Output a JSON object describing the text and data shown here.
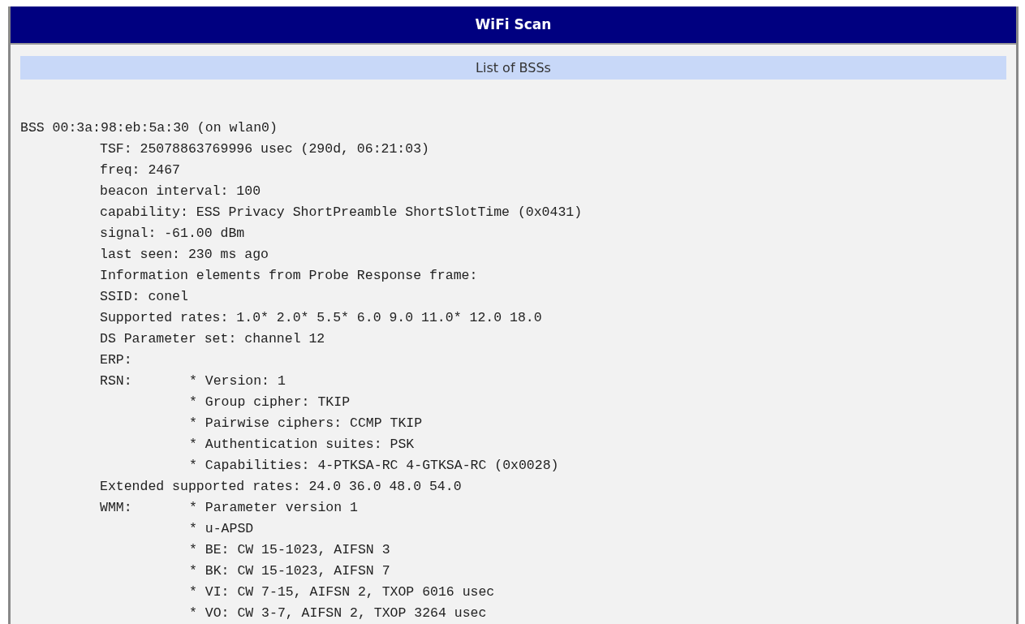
{
  "window": {
    "title": "WiFi Scan"
  },
  "section": {
    "title": "List of BSSs"
  },
  "scan": {
    "header": "BSS 00:3a:98:eb:5a:30 (on wlan0)",
    "fields": [
      {
        "text": "TSF: 25078863769996 usec (290d, 06:21:03)"
      },
      {
        "text": "freq: 2467"
      },
      {
        "text": "beacon interval: 100"
      },
      {
        "text": "capability: ESS Privacy ShortPreamble ShortSlotTime (0x0431)"
      },
      {
        "text": "signal: -61.00 dBm"
      },
      {
        "text": "last seen: 230 ms ago"
      },
      {
        "text": "Information elements from Probe Response frame:"
      },
      {
        "text": "SSID: conel"
      },
      {
        "text": "Supported rates: 1.0* 2.0* 5.5* 6.0 9.0 11.0* 12.0 18.0"
      },
      {
        "text": "DS Parameter set: channel 12"
      },
      {
        "text": "ERP:"
      },
      {
        "label": "RSN:",
        "items": [
          "* Version: 1",
          "* Group cipher: TKIP",
          "* Pairwise ciphers: CCMP TKIP",
          "* Authentication suites: PSK",
          "* Capabilities: 4-PTKSA-RC 4-GTKSA-RC (0x0028)"
        ]
      },
      {
        "text": "Extended supported rates: 24.0 36.0 48.0 54.0"
      },
      {
        "label": "WMM:",
        "items": [
          "* Parameter version 1",
          "* u-APSD",
          "* BE: CW 15-1023, AIFSN 3",
          "* BK: CW 15-1023, AIFSN 7",
          "* VI: CW 7-15, AIFSN 2, TXOP 6016 usec",
          "* VO: CW 3-7, AIFSN 2, TXOP 3264 usec"
        ]
      }
    ]
  }
}
